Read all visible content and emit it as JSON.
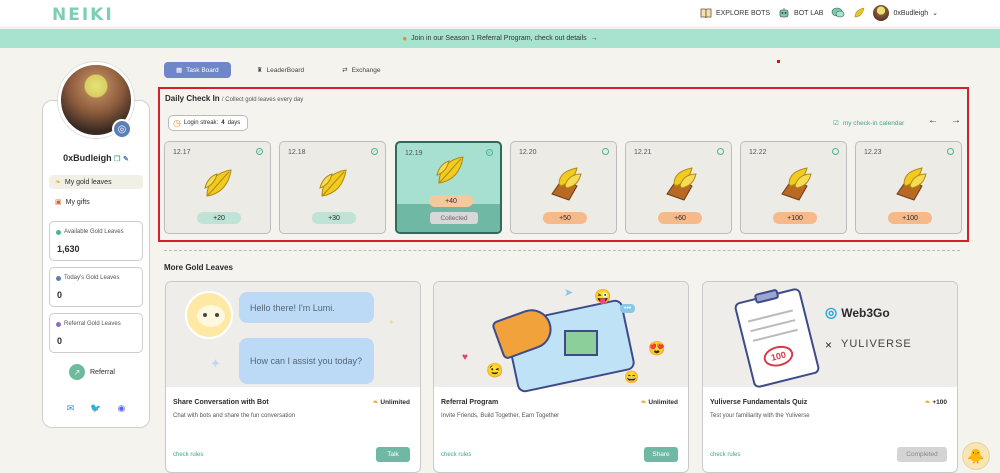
{
  "header": {
    "logo": "NEIKI",
    "nav": [
      {
        "label": "EXPLORE BOTS",
        "icon": "book-icon"
      },
      {
        "label": "BOT LAB",
        "icon": "robot-icon"
      }
    ],
    "user": "0xBudleigh"
  },
  "banner": {
    "text": "Join in our Season 1 Referral Program, check out details",
    "arrow": "→"
  },
  "sidebar": {
    "username": "0xBudleigh",
    "links": [
      {
        "label": "My gold leaves"
      },
      {
        "label": "My gifts"
      }
    ],
    "stats": [
      {
        "label": "Available Gold Leaves",
        "value": "1,630",
        "color": "#4fb38f"
      },
      {
        "label": "Today's Gold Leaves",
        "value": "0",
        "color": "#5c7fb8"
      },
      {
        "label": "Referral Gold Leaves",
        "value": "0",
        "color": "#8a6fc8"
      }
    ],
    "referral": "Referral"
  },
  "tabs": [
    {
      "label": "Task Board",
      "active": true
    },
    {
      "label": "LeaderBoard",
      "active": false
    },
    {
      "label": "Exchange",
      "active": false
    }
  ],
  "checkin": {
    "title": "Daily Check In",
    "subtitle": "/ Collect gold leaves every day",
    "streak_prefix": "Login streak:",
    "streak_days": "4",
    "streak_suffix": "days",
    "calendar_link": "my check-in calendar",
    "days": [
      {
        "date": "12.17",
        "points": "+20",
        "state": "claimed"
      },
      {
        "date": "12.18",
        "points": "+30",
        "state": "claimed"
      },
      {
        "date": "12.19",
        "points": "+40",
        "state": "today",
        "collected": "Collected"
      },
      {
        "date": "12.20",
        "points": "+50",
        "state": "future"
      },
      {
        "date": "12.21",
        "points": "+60",
        "state": "future"
      },
      {
        "date": "12.22",
        "points": "+100",
        "state": "future"
      },
      {
        "date": "12.23",
        "points": "+100",
        "state": "future"
      }
    ]
  },
  "more": {
    "title": "More Gold Leaves",
    "cards": [
      {
        "title": "Share Conversation with Bot",
        "desc": "Chat with bots and share the fun conversation",
        "reward": "Unlimited",
        "rules": "check rules",
        "button": "Talk",
        "bubble1": "Hello there! I'm Lumi.",
        "bubble2": "How can I assist you today?"
      },
      {
        "title": "Referral Program",
        "desc": "Invite Friends, Build Together, Earn Together",
        "reward": "Unlimited",
        "rules": "check rules",
        "button": "Share"
      },
      {
        "title": "Yuliverse Fundamentals Quiz",
        "desc": "Test your familiarity with the Yuliverse",
        "reward": "+100",
        "rules": "check rules",
        "button": "Completed",
        "score": "100",
        "brand1": "Web3Go",
        "brand2": "YULIVERSE",
        "times": "×"
      }
    ]
  }
}
